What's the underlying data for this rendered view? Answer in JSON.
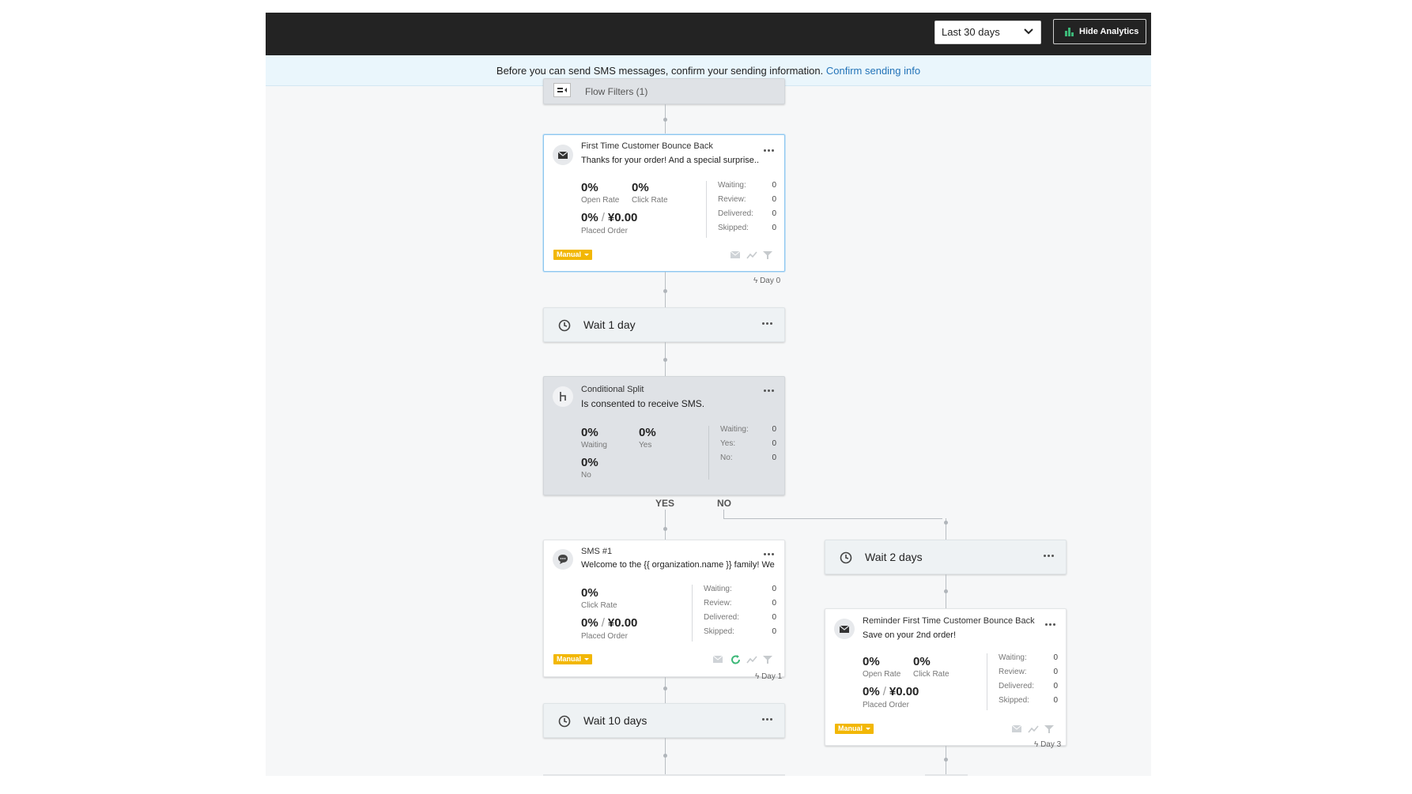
{
  "topbar": {
    "date_range": "Last 30 days",
    "hide_analytics": "Hide Analytics"
  },
  "banner": {
    "text": "Before you can send SMS messages, confirm your sending information.",
    "link": "Confirm sending info"
  },
  "flow_filters": {
    "label": "Flow Filters (1)"
  },
  "email1": {
    "title": "First Time Customer Bounce Back",
    "subject": "Thanks for your order! And a special surprise...",
    "open_rate": "0%",
    "open_rate_label": "Open Rate",
    "click_rate": "0%",
    "click_rate_label": "Click Rate",
    "placed_pct": "0%",
    "placed_value": "¥0.00",
    "placed_label": "Placed Order",
    "stats": [
      {
        "k": "Waiting:",
        "v": "0"
      },
      {
        "k": "Review:",
        "v": "0"
      },
      {
        "k": "Delivered:",
        "v": "0"
      },
      {
        "k": "Skipped:",
        "v": "0"
      }
    ],
    "mode": "Manual",
    "day": "Day 0"
  },
  "wait1": {
    "label": "Wait 1 day"
  },
  "split": {
    "title": "Conditional Split",
    "condition": "Is consented to receive SMS.",
    "waiting": "0%",
    "waiting_label": "Waiting",
    "yes": "0%",
    "yes_label": "Yes",
    "no": "0%",
    "no_label": "No",
    "stats": [
      {
        "k": "Waiting:",
        "v": "0"
      },
      {
        "k": "Yes:",
        "v": "0"
      },
      {
        "k": "No:",
        "v": "0"
      }
    ],
    "branch_yes": "YES",
    "branch_no": "NO"
  },
  "sms1": {
    "title": "SMS #1",
    "body": "Welcome to the {{ organization.name }} family! We ...",
    "click_rate": "0%",
    "click_rate_label": "Click Rate",
    "placed_pct": "0%",
    "placed_value": "¥0.00",
    "placed_label": "Placed Order",
    "stats": [
      {
        "k": "Waiting:",
        "v": "0"
      },
      {
        "k": "Review:",
        "v": "0"
      },
      {
        "k": "Delivered:",
        "v": "0"
      },
      {
        "k": "Skipped:",
        "v": "0"
      }
    ],
    "mode": "Manual",
    "day": "Day 1"
  },
  "wait10": {
    "label": "Wait 10 days"
  },
  "wait2": {
    "label": "Wait 2 days"
  },
  "email2": {
    "title": "Reminder First Time Customer Bounce Back",
    "subject": "Save on your 2nd order!",
    "open_rate": "0%",
    "open_rate_label": "Open Rate",
    "click_rate": "0%",
    "click_rate_label": "Click Rate",
    "placed_pct": "0%",
    "placed_value": "¥0.00",
    "placed_label": "Placed Order",
    "stats": [
      {
        "k": "Waiting:",
        "v": "0"
      },
      {
        "k": "Review:",
        "v": "0"
      },
      {
        "k": "Delivered:",
        "v": "0"
      },
      {
        "k": "Skipped:",
        "v": "0"
      }
    ],
    "mode": "Manual",
    "day": "Day 3"
  },
  "colors": {
    "topbar": "#232323",
    "badge": "#f2b705",
    "link": "#2273b8",
    "selected_border": "#8fc7ef"
  },
  "icons": [
    "chevron-down-icon",
    "bar-chart-icon",
    "filter-list-icon",
    "envelope-icon",
    "clock-icon",
    "split-icon",
    "chat-bubble-icon",
    "more-icon",
    "preview-icon",
    "trend-icon",
    "filter-icon",
    "bolt-icon",
    "refresh-icon"
  ]
}
